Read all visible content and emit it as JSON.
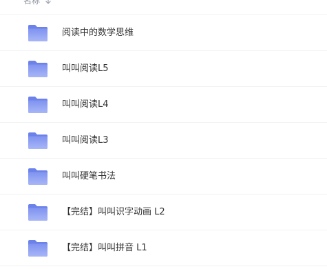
{
  "header": {
    "column_label": "名称",
    "sort_icon": "arrow-down-icon"
  },
  "files": [
    {
      "name": "阅读中的数学思维",
      "icon": "folder-icon"
    },
    {
      "name": "叫叫阅读L5",
      "icon": "folder-icon"
    },
    {
      "name": "叫叫阅读L4",
      "icon": "folder-icon"
    },
    {
      "name": "叫叫阅读L3",
      "icon": "folder-icon"
    },
    {
      "name": "叫叫硬笔书法",
      "icon": "folder-icon"
    },
    {
      "name": "【完结】叫叫识字动画 L2",
      "icon": "folder-icon"
    },
    {
      "name": "【完结】叫叫拼音 L1",
      "icon": "folder-icon"
    }
  ],
  "colors": {
    "folder_top": "#7f93f0",
    "folder_bottom": "#a8b6f7",
    "divider": "#f1f2f4",
    "text": "#333333",
    "header_text": "#8a8f99"
  }
}
